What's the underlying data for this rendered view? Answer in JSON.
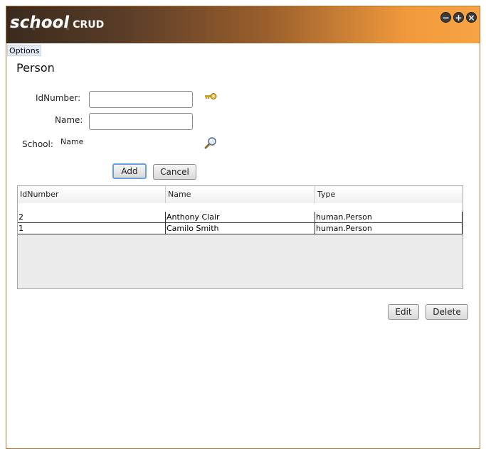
{
  "titlebar": {
    "logo_main": "school",
    "logo_sub": "CRUD",
    "buttons": {
      "minimize": "−",
      "maximize": "+",
      "close": "×"
    }
  },
  "menu": {
    "options": "Options"
  },
  "form": {
    "title": "Person",
    "id_label": "IdNumber:",
    "id_value": "",
    "name_label": "Name:",
    "name_value": "",
    "school_label": "School:",
    "school_value": "Name",
    "key_icon": "key-icon",
    "search_icon": "magnifier-icon"
  },
  "buttons": {
    "add": "Add",
    "cancel": "Cancel",
    "edit": "Edit",
    "delete": "Delete"
  },
  "table": {
    "columns": [
      "IdNumber",
      "Name",
      "Type"
    ],
    "rows": [
      [
        "2",
        "Anthony Clair",
        "human.Person"
      ],
      [
        "1",
        "Camilo Smith",
        "human.Person"
      ]
    ]
  },
  "colors": {
    "title_dark": "#3a2a1e",
    "title_accent": "#f6a444",
    "focus_border": "#6aa0d8"
  }
}
